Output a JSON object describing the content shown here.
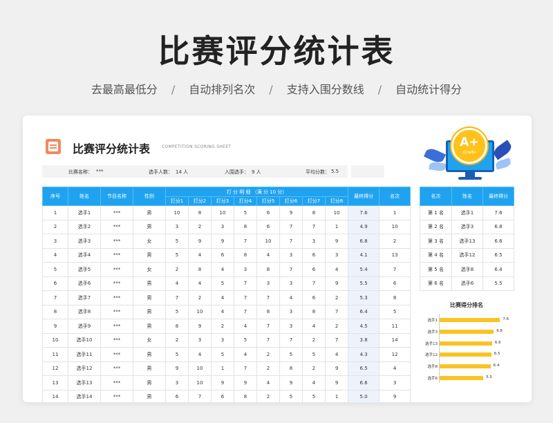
{
  "hero": {
    "title": "比赛评分统计表",
    "features": [
      "去最高最低分",
      "自动排列名次",
      "支持入围分数线",
      "自动统计得分"
    ],
    "separator": "/"
  },
  "sheet": {
    "title": "比赛评分统计表",
    "subtitle": "COMPETITION SCORING SHEET",
    "icon": "document-icon"
  },
  "info": {
    "event_name_label": "比赛名称：",
    "event_name_value": "***",
    "players_label": "选手人数：",
    "players_value": "14 人",
    "finalists_label": "入围选手：",
    "finalists_value": "9 人",
    "avg_label": "平均分数：",
    "avg_value": "5.5"
  },
  "badge": {
    "grade": "A+",
    "sub": "Grade"
  },
  "table": {
    "headers": {
      "index": "序号",
      "name": "姓名",
      "program": "节目名称",
      "gender": "性别",
      "scores_group": "打 分 明 细 （满 分 10 分）",
      "judges": [
        "打分1",
        "打分2",
        "打分3",
        "打分4",
        "打分5",
        "打分6",
        "打分7",
        "打分8"
      ],
      "final": "最终得分",
      "rank": "名次"
    },
    "rows": [
      {
        "idx": "1",
        "name": "选手1",
        "prog": "***",
        "gender": "男",
        "s": [
          "10",
          "8",
          "10",
          "5",
          "6",
          "9",
          "8",
          "10"
        ],
        "final": "7.6",
        "rank": "1"
      },
      {
        "idx": "2",
        "name": "选手2",
        "prog": "***",
        "gender": "男",
        "s": [
          "3",
          "2",
          "3",
          "8",
          "6",
          "7",
          "7",
          "1"
        ],
        "final": "4.9",
        "rank": "10"
      },
      {
        "idx": "3",
        "name": "选手3",
        "prog": "***",
        "gender": "女",
        "s": [
          "5",
          "9",
          "9",
          "7",
          "10",
          "7",
          "3",
          "9"
        ],
        "final": "6.8",
        "rank": "2"
      },
      {
        "idx": "4",
        "name": "选手4",
        "prog": "***",
        "gender": "男",
        "s": [
          "5",
          "4",
          "6",
          "8",
          "4",
          "3",
          "6",
          "3"
        ],
        "final": "4.1",
        "rank": "13"
      },
      {
        "idx": "5",
        "name": "选手5",
        "prog": "***",
        "gender": "女",
        "s": [
          "2",
          "8",
          "4",
          "3",
          "8",
          "7",
          "6",
          "4"
        ],
        "final": "5.4",
        "rank": "7"
      },
      {
        "idx": "6",
        "name": "选手6",
        "prog": "***",
        "gender": "男",
        "s": [
          "4",
          "4",
          "5",
          "7",
          "3",
          "3",
          "7",
          "9"
        ],
        "final": "5.5",
        "rank": "6"
      },
      {
        "idx": "7",
        "name": "选手7",
        "prog": "***",
        "gender": "男",
        "s": [
          "7",
          "2",
          "4",
          "7",
          "7",
          "4",
          "6",
          "2"
        ],
        "final": "5.3",
        "rank": "8"
      },
      {
        "idx": "8",
        "name": "选手8",
        "prog": "***",
        "gender": "男",
        "s": [
          "5",
          "10",
          "4",
          "7",
          "8",
          "3",
          "8",
          "7"
        ],
        "final": "6.4",
        "rank": "5"
      },
      {
        "idx": "9",
        "name": "选手9",
        "prog": "***",
        "gender": "男",
        "s": [
          "8",
          "9",
          "2",
          "4",
          "7",
          "3",
          "4",
          "2"
        ],
        "final": "4.5",
        "rank": "11"
      },
      {
        "idx": "10",
        "name": "选手10",
        "prog": "***",
        "gender": "女",
        "s": [
          "2",
          "3",
          "3",
          "5",
          "7",
          "7",
          "2",
          "7"
        ],
        "final": "3.8",
        "rank": "14"
      },
      {
        "idx": "11",
        "name": "选手11",
        "prog": "***",
        "gender": "男",
        "s": [
          "5",
          "4",
          "5",
          "4",
          "2",
          "5",
          "5",
          "4"
        ],
        "final": "4.3",
        "rank": "12"
      },
      {
        "idx": "12",
        "name": "选手12",
        "prog": "***",
        "gender": "男",
        "s": [
          "9",
          "10",
          "1",
          "7",
          "2",
          "8",
          "2",
          "9"
        ],
        "final": "6.5",
        "rank": "4"
      },
      {
        "idx": "13",
        "name": "选手13",
        "prog": "***",
        "gender": "男",
        "s": [
          "3",
          "10",
          "9",
          "9",
          "4",
          "9",
          "4",
          "9"
        ],
        "final": "6.6",
        "rank": "3"
      },
      {
        "idx": "14",
        "name": "选手14",
        "prog": "***",
        "gender": "男",
        "s": [
          "6",
          "7",
          "6",
          "8",
          "2",
          "5",
          "5",
          "1"
        ],
        "final": "5.0",
        "rank": "9"
      }
    ]
  },
  "ranking": {
    "headers": [
      "名次",
      "姓名",
      "最终得分"
    ],
    "rows": [
      {
        "place": "第 1 名",
        "name": "选手1",
        "score": "7.6"
      },
      {
        "place": "第 2 名",
        "name": "选手3",
        "score": "6.8"
      },
      {
        "place": "第 3 名",
        "name": "选手13",
        "score": "6.6"
      },
      {
        "place": "第 4 名",
        "name": "选手12",
        "score": "6.5"
      },
      {
        "place": "第 5 名",
        "name": "选手8",
        "score": "6.4"
      },
      {
        "place": "第 6 名",
        "name": "选手6",
        "score": "5.5"
      }
    ]
  },
  "chart_data": {
    "type": "bar",
    "orientation": "horizontal",
    "title": "比赛得分排名",
    "categories": [
      "选手1",
      "选手3",
      "选手13",
      "选手12",
      "选手8",
      "选手6"
    ],
    "values": [
      7.6,
      6.8,
      6.6,
      6.5,
      6.4,
      5.5
    ],
    "xlim": [
      0,
      8
    ],
    "bar_color": "#f9c423"
  },
  "colors": {
    "header_blue": "#1fa3f0",
    "bar_yellow": "#f9c423",
    "final_col_bg": "#eef3fb"
  }
}
